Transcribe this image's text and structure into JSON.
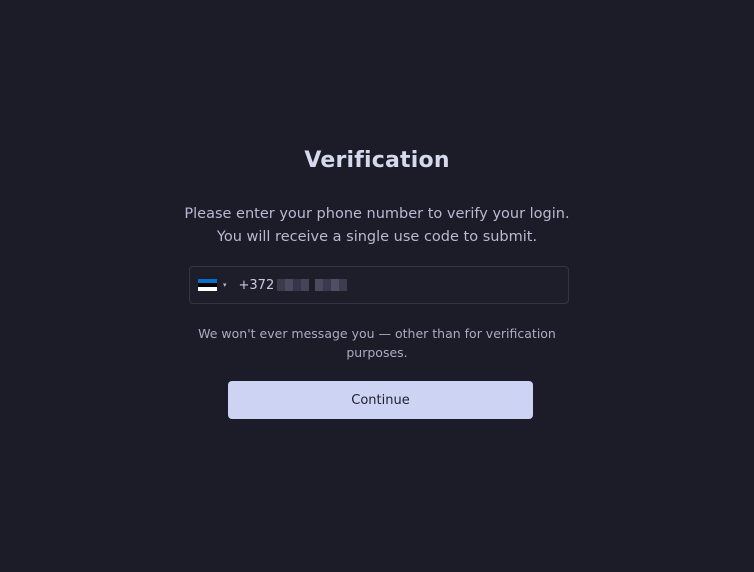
{
  "heading": "Verification",
  "instructions": {
    "line1": "Please enter your phone number to verify your login.",
    "line2": "You will receive a single use code to submit."
  },
  "phone": {
    "country_code": "+372",
    "country_flag": "estonia-flag-icon",
    "flag_colors": [
      "#0072ce",
      "#000000",
      "#ffffff"
    ],
    "caret": "▾"
  },
  "note": {
    "line1": "We won't ever message you — other than for verification",
    "line2": "purposes."
  },
  "continue_label": "Continue",
  "colors": {
    "background": "#1c1c28",
    "button": "#cdd3f3"
  }
}
